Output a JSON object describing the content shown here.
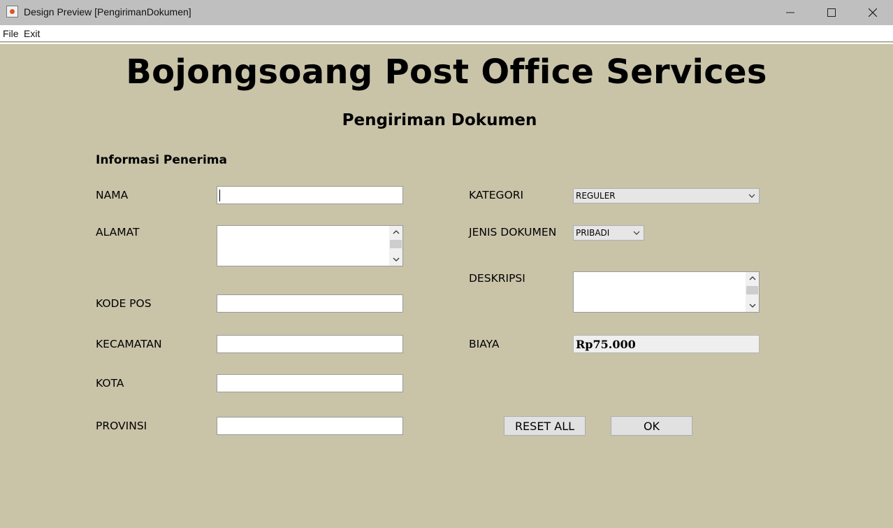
{
  "window": {
    "title": "Design Preview [PengirimanDokumen]",
    "controls": [
      "minimize-icon",
      "maximize-icon",
      "close-icon"
    ]
  },
  "menu": {
    "file": "File",
    "exit": "Exit"
  },
  "header": {
    "title": "Bojongsoang Post Office Services",
    "subtitle": "Pengiriman Dokumen"
  },
  "recipient": {
    "section_title": "Informasi Penerima",
    "nama_label": "NAMA",
    "nama_value": "",
    "alamat_label": "ALAMAT",
    "alamat_value": "",
    "kode_pos_label": "KODE POS",
    "kode_pos_value": "",
    "kecamatan_label": "KECAMATAN",
    "kecamatan_value": "",
    "kota_label": "KOTA",
    "kota_value": "",
    "provinsi_label": "PROVINSI",
    "provinsi_value": ""
  },
  "document": {
    "kategori_label": "KATEGORI",
    "kategori_selected": "REGULER",
    "jenis_label": "JENIS DOKUMEN",
    "jenis_selected": "PRIBADI",
    "deskripsi_label": "DESKRIPSI",
    "deskripsi_value": "",
    "biaya_label": "BIAYA",
    "biaya_value": "Rp75.000"
  },
  "actions": {
    "reset_label": "RESET ALL",
    "ok_label": "OK"
  },
  "colors": {
    "background": "#c9c3a8",
    "titlebar": "#bfbfbf"
  }
}
